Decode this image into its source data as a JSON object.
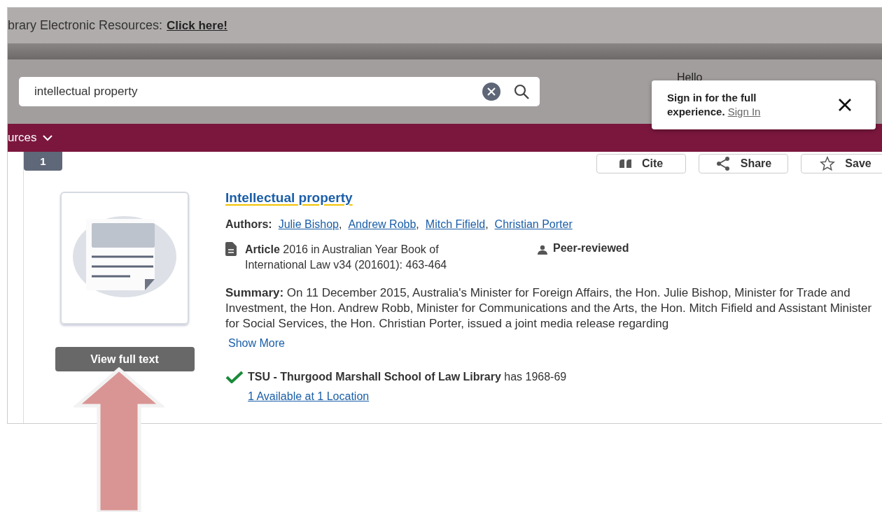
{
  "banner": {
    "text": "brary Electronic Resources:",
    "link": "Click here!"
  },
  "search": {
    "value": "intellectual property"
  },
  "greeting": "Hello",
  "signin_popup": {
    "text": "Sign in for the full experience.",
    "link": "Sign In"
  },
  "nav": {
    "label": "urces"
  },
  "result": {
    "number": "1",
    "actions": [
      {
        "kind": "cite",
        "label": "Cite"
      },
      {
        "kind": "share",
        "label": "Share"
      },
      {
        "kind": "save",
        "label": "Save"
      }
    ],
    "title": "Intellectual property",
    "authors_label": "Authors:",
    "authors": [
      "Julie Bishop",
      "Andrew Robb",
      "Mitch Fifield",
      "Christian Porter"
    ],
    "author_separator": ",",
    "citation": "**Article** 2016 in Australian Year Book of International Law v34 (201601): 463-464",
    "peer_reviewed": "Peer-reviewed",
    "summary": "**Summary:**  On 11 December 2015, Australia's Minister for Foreign Affairs, the Hon. Julie Bishop, Minister for Trade and Investment, the Hon. Andrew Robb, Minister for Communications and the Arts, the Hon. Mitch Fifield and Assistant Minister for Social Services, the Hon. Christian Porter, issued a joint media release regarding",
    "show_more": "Show More",
    "availability": "**TSU - Thurgood Marshall School of Law Library** has 1968-69",
    "location_link": "1 Available at 1 Location",
    "view_button": "View full text"
  }
}
